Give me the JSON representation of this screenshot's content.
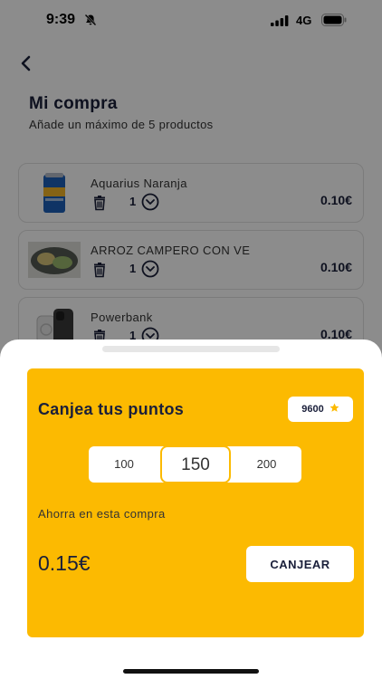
{
  "status_bar": {
    "time": "9:39",
    "network": "4G"
  },
  "header": {
    "title": "Mi compra",
    "subtitle": "Añade un máximo de 5 productos"
  },
  "products": [
    {
      "name": "Aquarius Naranja",
      "quantity": "1",
      "price": "0.10€"
    },
    {
      "name": "ARROZ CAMPERO CON VE",
      "quantity": "1",
      "price": "0.10€"
    },
    {
      "name": "Powerbank",
      "quantity": "1",
      "price": "0.10€"
    }
  ],
  "redeem_sheet": {
    "title": "Canjea tus puntos",
    "points_balance": "9600",
    "options": [
      "100",
      "150",
      "200"
    ],
    "selected_option": "150",
    "save_label": "Ahorra en esta compra",
    "save_amount": "0.15€",
    "redeem_button": "CANJEAR"
  },
  "colors": {
    "accent": "#fcba01",
    "text_dark": "#1a1f3a"
  },
  "icons": {
    "back": "chevron-left-icon",
    "trash": "trash-icon",
    "quantity_toggle": "chevron-down-circle-icon",
    "points": "star-icon",
    "mute": "bell-off-icon"
  }
}
